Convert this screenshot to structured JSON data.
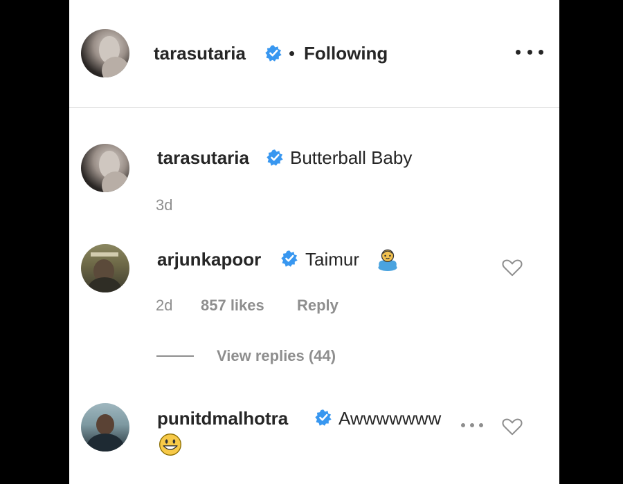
{
  "post_header": {
    "username": "tarasutaria",
    "separator": "•",
    "follow_status": "Following"
  },
  "caption": {
    "username": "tarasutaria",
    "text": "Butterball Baby",
    "time": "3d"
  },
  "comments": [
    {
      "username": "arjunkapoor",
      "text": "Taimur",
      "emoji": "baby-face-emoji",
      "time": "2d",
      "likes": "857 likes",
      "reply": "Reply",
      "view_replies": "View replies (44)"
    },
    {
      "username": "punitdmalhotra",
      "text": "Awwwwwww",
      "emoji": "grinning-face-emoji"
    }
  ],
  "colors": {
    "verified": "#3897f0",
    "text": "#262626",
    "muted": "#8e8e8e"
  }
}
